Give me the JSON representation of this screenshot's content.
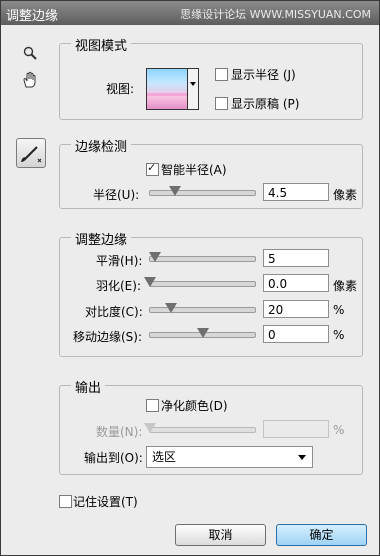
{
  "window": {
    "title": "调整边缘",
    "watermark": "思缘设计论坛 WWW.MISSYUAN.COM"
  },
  "view_mode": {
    "legend": "视图模式",
    "view_label": "视图:",
    "show_radius": {
      "label": "显示半径 (J)",
      "checked": false
    },
    "show_original": {
      "label": "显示原稿 (P)",
      "checked": false
    }
  },
  "edge_detection": {
    "legend": "边缘检测",
    "smart_radius": {
      "label": "智能半径(A)",
      "checked": true
    },
    "radius": {
      "label": "半径(U):",
      "value": "4.5",
      "unit": "像素"
    }
  },
  "adjust_edge": {
    "legend": "调整边缘",
    "smooth": {
      "label": "平滑(H):",
      "value": "5",
      "unit": ""
    },
    "feather": {
      "label": "羽化(E):",
      "value": "0.0",
      "unit": "像素"
    },
    "contrast": {
      "label": "对比度(C):",
      "value": "20",
      "unit": "%"
    },
    "shift_edge": {
      "label": "移动边缘(S):",
      "value": "0",
      "unit": "%"
    }
  },
  "output": {
    "legend": "输出",
    "decontaminate": {
      "label": "净化颜色(D)",
      "checked": false
    },
    "amount": {
      "label": "数量(N):",
      "value": "",
      "unit": "%"
    },
    "output_to": {
      "label": "输出到(O):",
      "value": "选区"
    }
  },
  "remember": {
    "label": "记住设置(T)",
    "checked": false
  },
  "buttons": {
    "cancel": "取消",
    "ok": "确定"
  },
  "sliders": {
    "radius": 0.24,
    "smooth": 0.05,
    "feather": 0.0,
    "contrast": 0.2,
    "shift_edge": 0.5,
    "amount": 0.0
  },
  "icons": [
    "zoom-icon",
    "hand-icon",
    "refine-radius-brush-icon",
    "close-icon"
  ]
}
